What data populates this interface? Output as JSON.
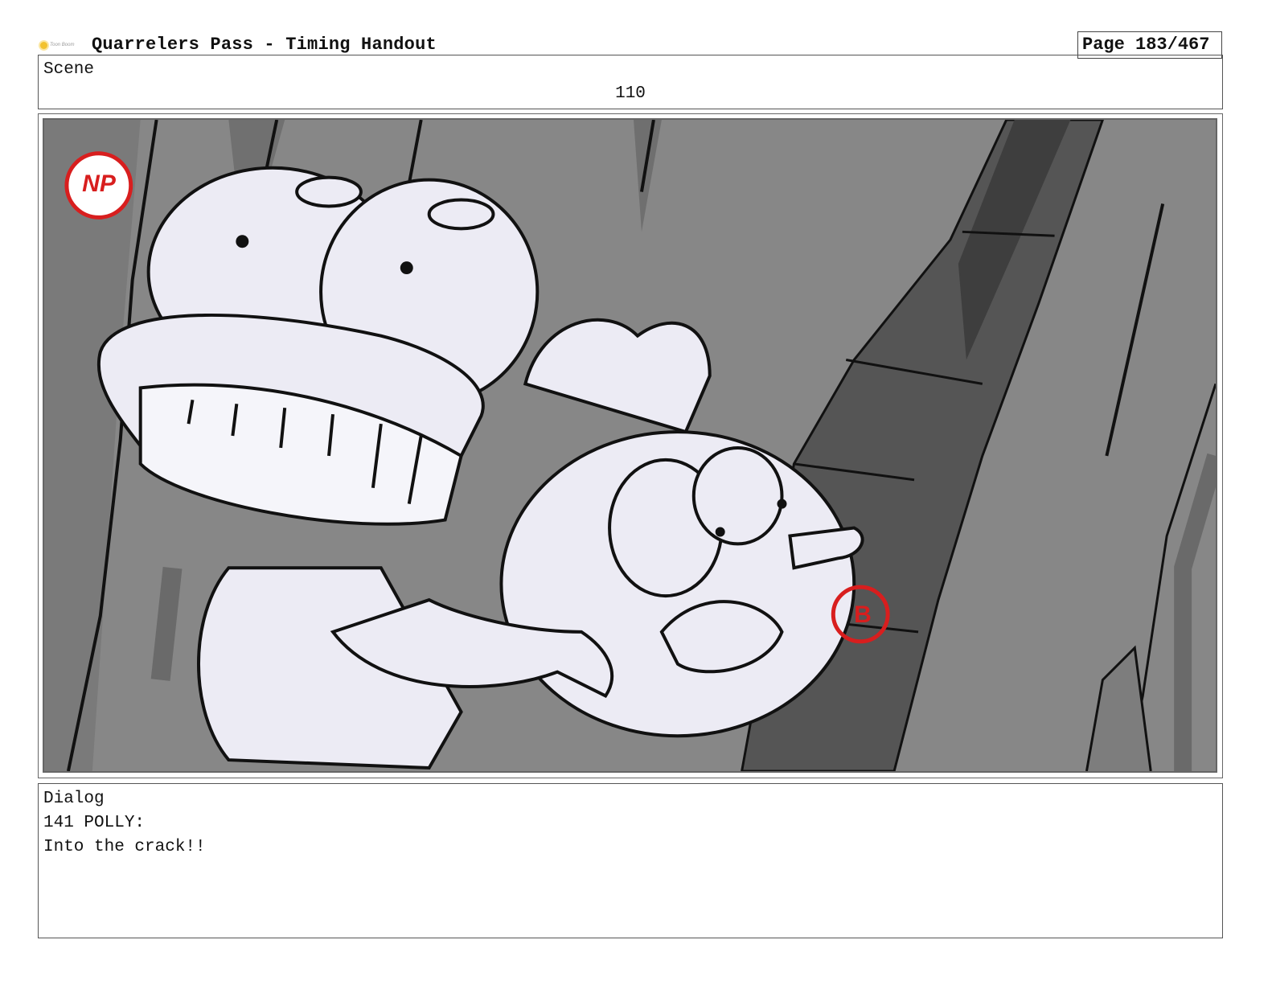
{
  "header": {
    "logo_text": "Toon Boom",
    "title": "Quarrelers Pass - Timing Handout",
    "page": "Page 183/467"
  },
  "scene": {
    "label": "Scene",
    "number": "110"
  },
  "panel": {
    "marks": [
      "NP",
      "B"
    ],
    "mark_color": "#d81e1e"
  },
  "dialog": {
    "label": "Dialog",
    "speaker": "141 POLLY:",
    "line": "Into the crack!!"
  }
}
